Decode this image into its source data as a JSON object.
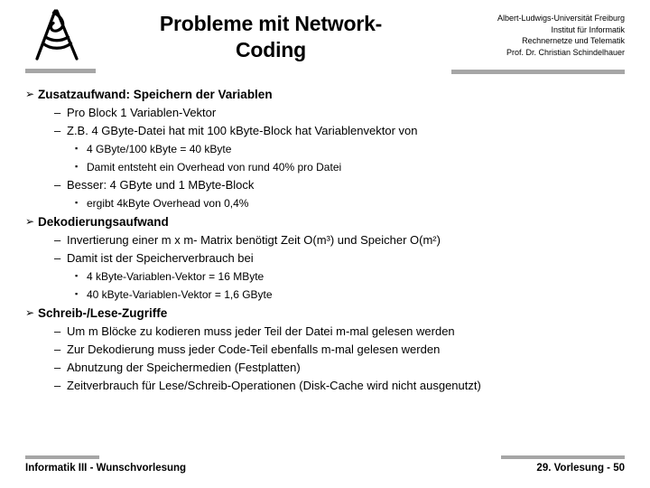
{
  "header": {
    "logo_icon": "freiburg-university-seal-icon",
    "title": "Probleme mit Network-Coding",
    "title_line_1": "Probleme mit Network-",
    "title_line_2": "Coding",
    "institution_lines": [
      "Albert-Ludwigs-Universität Freiburg",
      "Institut für Informatik",
      "Rechnernetze und Telematik",
      "Prof. Dr. Christian Schindelhauer"
    ],
    "rule_color": "#a6a6a6"
  },
  "bullets": [
    {
      "level": 1,
      "marker": "➢",
      "text": "Zusatzaufwand: Speichern der Variablen"
    },
    {
      "level": 2,
      "marker": "–",
      "text": "Pro Block 1 Variablen-Vektor"
    },
    {
      "level": 2,
      "marker": "–",
      "text": "Z.B. 4 GByte-Datei hat mit 100 kByte-Block hat Variablenvektor von"
    },
    {
      "level": 3,
      "marker": "▪",
      "text": "4 GByte/100 kByte = 40 kByte"
    },
    {
      "level": 3,
      "marker": "▪",
      "text": "Damit entsteht ein Overhead von rund 40% pro Datei"
    },
    {
      "level": 2,
      "marker": "–",
      "text": "Besser: 4 GByte und 1 MByte-Block"
    },
    {
      "level": 3,
      "marker": "▪",
      "text": "ergibt 4kByte Overhead von 0,4%"
    },
    {
      "level": 1,
      "marker": "➢",
      "text": "Dekodierungsaufwand"
    },
    {
      "level": 2,
      "marker": "–",
      "text": "Invertierung einer m x m- Matrix benötigt Zeit O(m³) und Speicher O(m²)"
    },
    {
      "level": 2,
      "marker": "–",
      "text": "Damit ist der Speicherverbrauch bei"
    },
    {
      "level": 3,
      "marker": "▪",
      "text": "4 kByte-Variablen-Vektor = 16 MByte"
    },
    {
      "level": 3,
      "marker": "▪",
      "text": "40 kByte-Variablen-Vektor = 1,6 GByte"
    },
    {
      "level": 1,
      "marker": "➢",
      "text": "Schreib-/Lese-Zugriffe"
    },
    {
      "level": 2,
      "marker": "–",
      "text": "Um m Blöcke zu kodieren muss jeder Teil der Datei m-mal gelesen werden"
    },
    {
      "level": 2,
      "marker": "–",
      "text": "Zur Dekodierung muss jeder Code-Teil ebenfalls m-mal gelesen werden"
    },
    {
      "level": 2,
      "marker": "–",
      "text": "Abnutzung der Speichermedien (Festplatten)"
    },
    {
      "level": 2,
      "marker": "–",
      "text": "Zeitverbrauch für Lese/Schreib-Operationen (Disk-Cache wird nicht ausgenutzt)"
    }
  ],
  "footer": {
    "left_text": "Informatik III - Wunschvorlesung",
    "right_text": "29. Vorlesung - 50",
    "rule_color": "#a6a6a6"
  }
}
